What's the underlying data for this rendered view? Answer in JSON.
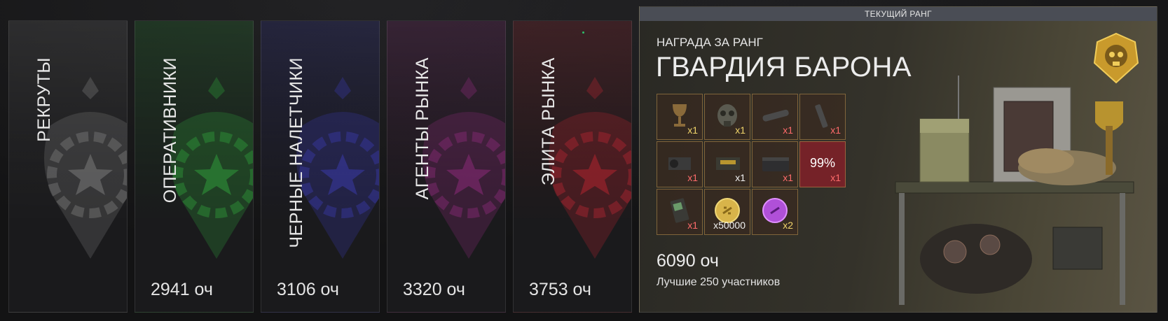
{
  "ranks": [
    {
      "name": "РЕКРУТЫ",
      "points": "",
      "color": "#7a7a7a"
    },
    {
      "name": "ОПЕРАТИВНИКИ",
      "points": "2941 оч",
      "color": "#2f9a3a"
    },
    {
      "name": "ЧЕРНЫЕ НАЛЕТЧИКИ",
      "points": "3106 оч",
      "color": "#3a3aa8"
    },
    {
      "name": "АГЕНТЫ РЫНКА",
      "points": "3320 оч",
      "color": "#8a2a78"
    },
    {
      "name": "ЭЛИТА РЫНКА",
      "points": "3753 оч",
      "color": "#b02530"
    }
  ],
  "current": {
    "header": "ТЕКУЩИЙ РАНГ",
    "reward_caption": "НАГРАДА ЗА РАНГ",
    "title": "ГВАРДИЯ БАРОНА",
    "points": "6090 оч",
    "participants": "Лучшие 250 участников",
    "badge_icon": "golden-skull-badge-icon"
  },
  "rewards": [
    {
      "icon": "goblet-icon",
      "qty": "x1",
      "qty_color": "yellow"
    },
    {
      "icon": "gas-mask-icon",
      "qty": "x1",
      "qty_color": "yellow"
    },
    {
      "icon": "suppressor-icon",
      "qty": "x1",
      "qty_color": "red"
    },
    {
      "icon": "weapon-part-icon",
      "qty": "x1",
      "qty_color": "red"
    },
    {
      "icon": "camera-icon",
      "qty": "x1",
      "qty_color": "red"
    },
    {
      "icon": "ammo-box-icon",
      "qty": "x1",
      "qty_color": "white"
    },
    {
      "icon": "weapon-case-icon",
      "qty": "x1",
      "qty_color": "red"
    },
    {
      "icon": "percent-boost-icon",
      "qty": "x1",
      "qty_color": "red",
      "label": "99%"
    },
    {
      "icon": "radio-device-icon",
      "qty": "x1",
      "qty_color": "red"
    },
    {
      "icon": "gold-coin-icon",
      "qty": "x50000",
      "qty_color": "white"
    },
    {
      "icon": "purple-coin-icon",
      "qty": "x2",
      "qty_color": "yellow"
    }
  ]
}
